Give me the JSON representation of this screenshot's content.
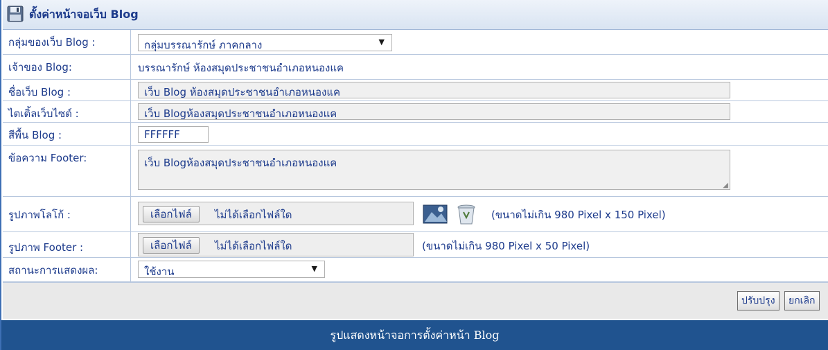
{
  "window": {
    "title": "ตั้งค่าหน้าจอเว็บ Blog",
    "title_icon": "save-disk-icon"
  },
  "form": {
    "group": {
      "label": "กลุ่มของเว็บ Blog :",
      "selected": "กลุ่มบรรณารักษ์ ภาคกลาง"
    },
    "owner": {
      "label": "เจ้าของ Blog:",
      "value": "บรรณารักษ์ ห้องสมุดประชาชนอำเภอหนองแค"
    },
    "blog_name": {
      "label": "ชื่อเว็บ Blog :",
      "value": "เว็บ Blog ห้องสมุดประชาชนอำเภอหนองแค"
    },
    "site_title": {
      "label": "ไตเติ้ลเว็บไซต์ :",
      "value": "เว็บ Blogห้องสมุดประชาชนอำเภอหนองแค"
    },
    "bg_color": {
      "label": "สีพื้น Blog :",
      "value": "FFFFFF"
    },
    "footer_text": {
      "label": "ข้อความ Footer:",
      "value": "เว็บ Blogห้องสมุดประชาชนอำเภอหนองแค"
    },
    "logo": {
      "label": "รูปภาพโลโก้ :",
      "button": "เลือกไฟล์",
      "status": "ไม่ได้เลือกไฟล์ใด",
      "note": "(ขนาดไม่เกิน 980 Pixel x 150 Pixel)",
      "icons": [
        "image-preview-icon",
        "trash-icon"
      ]
    },
    "footer_image": {
      "label": "รูปภาพ Footer :",
      "button": "เลือกไฟล์",
      "status": "ไม่ได้เลือกไฟล์ใด",
      "note": "(ขนาดไม่เกิน 980 Pixel x 50 Pixel)"
    },
    "display_status": {
      "label": "สถานะการแสดงผล:",
      "selected": "ใช้งาน"
    }
  },
  "actions": {
    "update": "ปรับปรุง",
    "cancel": "ยกเลิก"
  },
  "caption": "รูปแสดงหน้าจอการตั้งค่าหน้า Blog",
  "colors": {
    "caption_bg": "#20538f",
    "text": "#1d3b8c",
    "border": "#b7c7de"
  }
}
